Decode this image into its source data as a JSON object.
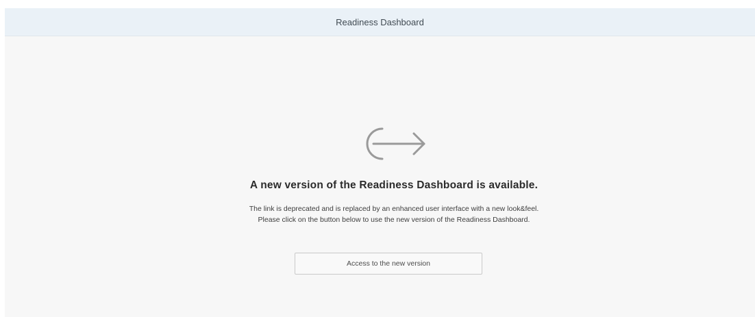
{
  "header": {
    "title": "Readiness Dashboard"
  },
  "notice": {
    "icon": "sign-out-icon",
    "headline": "A new version of the Readiness Dashboard is available.",
    "description_line1": "The link is deprecated and is replaced by an enhanced user interface with a new look&feel.",
    "description_line2": "Please click on the button below to use the new version of the Readiness Dashboard."
  },
  "cta": {
    "label": "Access to the new version"
  },
  "colors": {
    "header_bg": "#eaf1f7",
    "content_bg": "#f7f7f7",
    "icon_gray": "#9a9a9a"
  }
}
